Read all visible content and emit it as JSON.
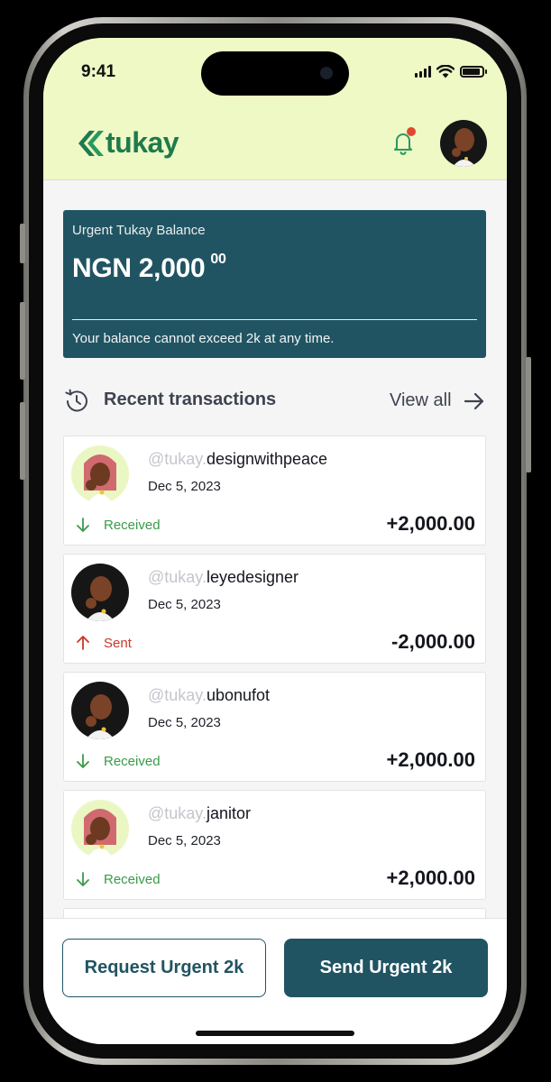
{
  "status_bar": {
    "time": "9:41"
  },
  "header": {
    "logo_text": "tukay",
    "brand_color": "#1f7a4d",
    "notification_dot_color": "#e0492f"
  },
  "balance": {
    "label": "Urgent Tukay Balance",
    "amount": "NGN 2,000",
    "cents": "00",
    "note": "Your balance cannot exceed 2k at any time."
  },
  "recent": {
    "title": "Recent transactions",
    "view_all": "View all"
  },
  "transactions": [
    {
      "prefix": "@tukay.",
      "name": "designwithpeace",
      "date": "Dec 5, 2023",
      "direction": "Received",
      "amount": "+2,000.00",
      "avatar": "woman-pink-hair"
    },
    {
      "prefix": "@tukay.",
      "name": "leyedesigner",
      "date": "Dec 5, 2023",
      "direction": "Sent",
      "amount": "-2,000.00",
      "avatar": "man-dark"
    },
    {
      "prefix": "@tukay.",
      "name": "ubonufot",
      "date": "Dec 5, 2023",
      "direction": "Received",
      "amount": "+2,000.00",
      "avatar": "man-dark"
    },
    {
      "prefix": "@tukay.",
      "name": "janitor",
      "date": "Dec 5, 2023",
      "direction": "Received",
      "amount": "+2,000.00",
      "avatar": "woman-pink-hair"
    }
  ],
  "actions": {
    "request_label": "Request Urgent 2k",
    "send_label": "Send Urgent 2k"
  },
  "colors": {
    "primary": "#215462",
    "header_bg": "#eef9c5",
    "received": "#3a9b48",
    "sent": "#c8362c"
  }
}
